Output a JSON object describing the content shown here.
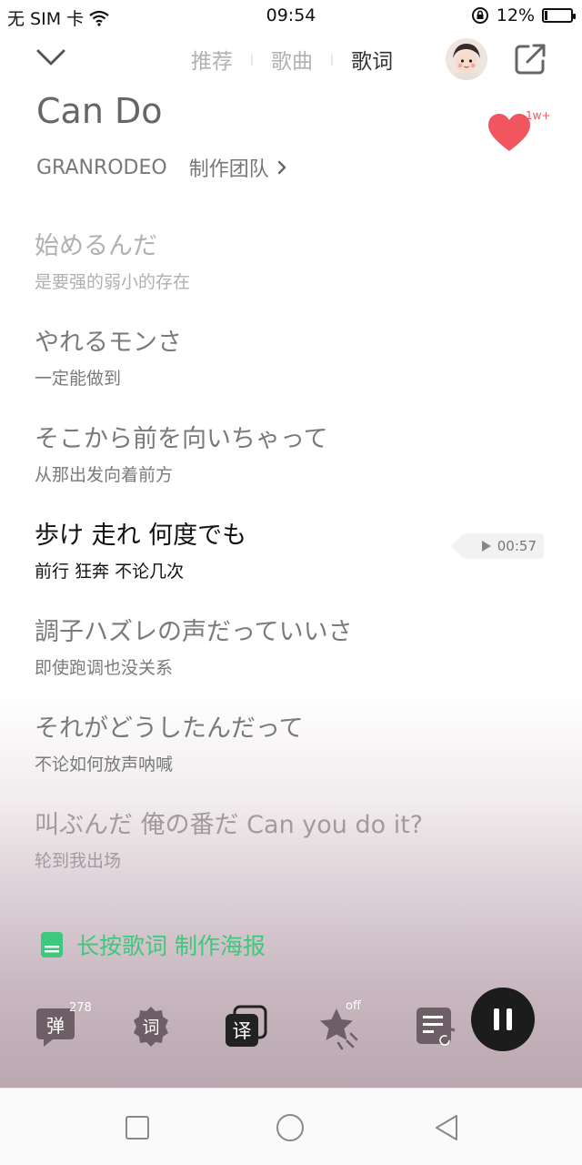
{
  "status_bar": {
    "carrier": "无 SIM 卡",
    "time": "09:54",
    "battery_percent": "12%",
    "battery_level": 0.12
  },
  "top_bar": {
    "tabs": [
      "推荐",
      "歌曲",
      "歌词"
    ],
    "active_tab": "歌词"
  },
  "song": {
    "title": "Can Do",
    "artist": "GRANRODEO",
    "team_link": "制作团队",
    "likes": "1w+"
  },
  "lyrics": [
    {
      "jp": "始めるんだ",
      "cn": "是要强的弱小的存在"
    },
    {
      "jp": "やれるモンさ",
      "cn": "一定能做到"
    },
    {
      "jp": "そこから前を向いちゃって",
      "cn": "从那出发向着前方"
    },
    {
      "jp": "歩け 走れ 何度でも",
      "cn": "前行 狂奔 不论几次"
    },
    {
      "jp": "調子ハズレの声だっていいさ",
      "cn": "即使跑调也没关系"
    },
    {
      "jp": "それがどうしたんだって",
      "cn": "不论如何放声呐喊"
    },
    {
      "jp": "叫ぶんだ 俺の番だ Can you do it?",
      "cn": "轮到我出场"
    }
  ],
  "seek_time": "00:57",
  "poster_hint": "长按歌词 制作海报",
  "controls": {
    "danmaku_label": "弹",
    "danmaku_count": "278",
    "lyrics_label": "词",
    "translate_label": "译",
    "star_badge": "off"
  },
  "colors": {
    "accent_green": "#3ec87e",
    "heart_red": "#f05560"
  }
}
